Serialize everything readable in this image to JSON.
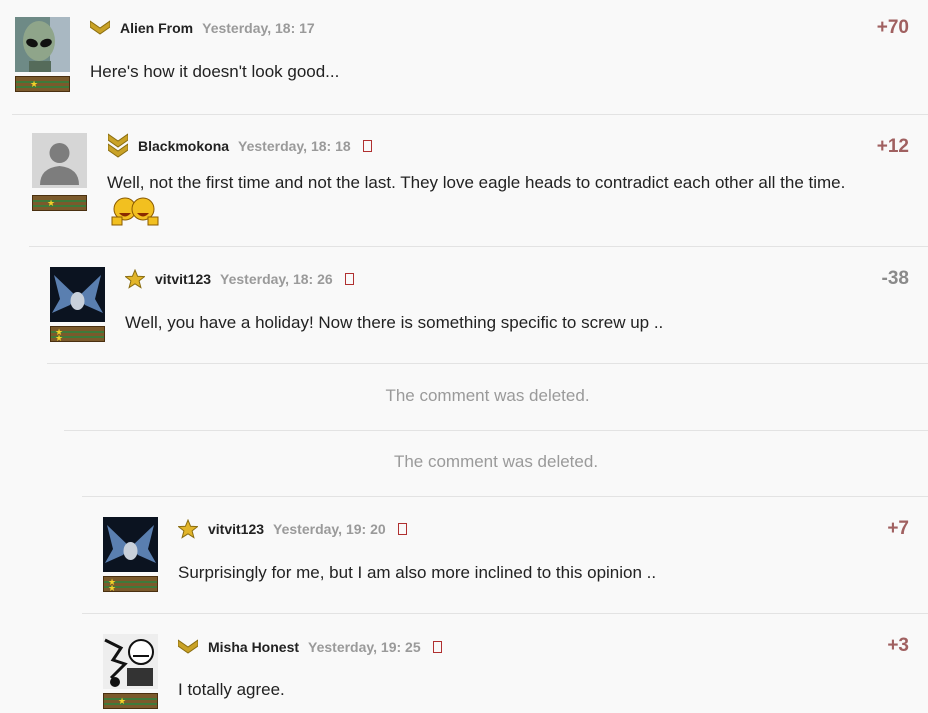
{
  "comments": [
    {
      "author": "Alien From",
      "time": "Yesterday, 18: 17",
      "score": "+70",
      "text": "Here's how it doesn't look good...",
      "rank_icon": "chevron-rank-icon"
    },
    {
      "author": "Blackmokona",
      "time": "Yesterday, 18: 18",
      "score": "+12",
      "text": "Well, not the first time and not the last. They love eagle heads to contradict each other all the time.",
      "rank_icon": "double-chevron-rank-icon"
    },
    {
      "author": "vitvit123",
      "time": "Yesterday, 18: 26",
      "score": "-38",
      "text": "Well, you have a holiday! Now there is something specific to screw up ..",
      "rank_icon": "star-rank-icon"
    },
    {
      "deleted_text": "The comment was deleted."
    },
    {
      "deleted_text": "The comment was deleted."
    },
    {
      "author": "vitvit123",
      "time": "Yesterday, 19: 20",
      "score": "+7",
      "text": "Surprisingly for me, but I am also more inclined to this opinion ..",
      "rank_icon": "star-rank-icon"
    },
    {
      "author": "Misha Honest",
      "time": "Yesterday, 19: 25",
      "score": "+3",
      "text": "I totally agree.",
      "rank_icon": "chevron-rank-icon"
    }
  ],
  "colors": {
    "positive_score": "#a06060",
    "negative_score": "#8a8a8a",
    "timestamp": "#9a9a9a",
    "rank_gold": "#c9a227"
  },
  "icons": {
    "flag": "report-flag-icon",
    "emoticon": "laughing-emoticon-icon"
  }
}
